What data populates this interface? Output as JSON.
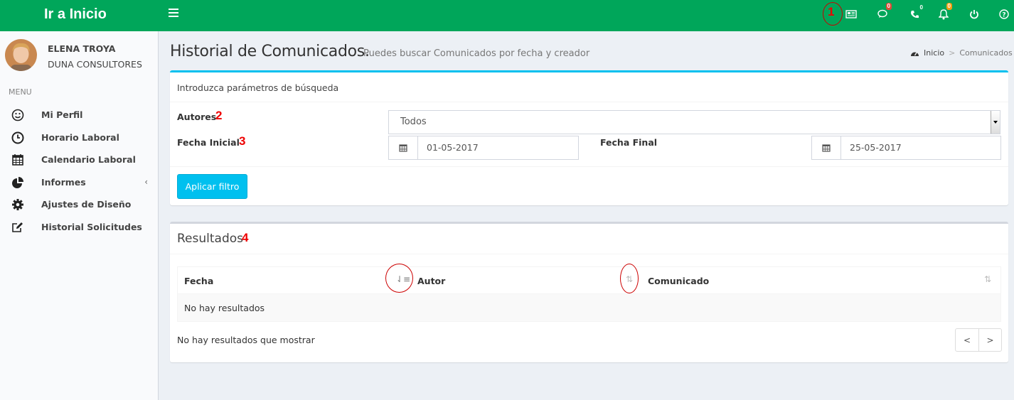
{
  "header": {
    "logo_text": "Ir a Inicio",
    "badges": {
      "messages": "0",
      "calls": "0",
      "notifications": "0"
    },
    "colors": {
      "bar": "#00a65a",
      "badge_red": "#dd4b39",
      "badge_orange": "#f39c12"
    }
  },
  "annotations": {
    "a1": "1",
    "a2": "2",
    "a3": "3",
    "a4": "4"
  },
  "sidebar": {
    "user_name": "ELENA TROYA",
    "user_company": "DUNA CONSULTORES",
    "menu_header": "MENU",
    "items": [
      {
        "label": "Mi Perfil",
        "icon": "smile-icon"
      },
      {
        "label": "Horario Laboral",
        "icon": "clock-icon"
      },
      {
        "label": "Calendario Laboral",
        "icon": "calendar-icon"
      },
      {
        "label": "Informes",
        "icon": "pie-chart-icon"
      },
      {
        "label": "Ajustes de Diseño",
        "icon": "gear-icon"
      },
      {
        "label": "Historial Solicitudes",
        "icon": "edit-icon"
      }
    ]
  },
  "page": {
    "title": "Historial de Comunicados.",
    "subtitle": "Puedes buscar Comunicados por fecha y creador",
    "breadcrumb": {
      "home": "Inicio",
      "separator": ">",
      "current": "Comunicados"
    }
  },
  "search": {
    "heading": "Introduzca parámetros de búsqueda",
    "autores_label": "Autores",
    "autores_value": "Todos",
    "fecha_inicial_label": "Fecha Inicial",
    "fecha_inicial_value": "01-05-2017",
    "fecha_final_label": "Fecha Final",
    "fecha_final_value": "25-05-2017",
    "apply_button": "Aplicar filtro"
  },
  "results": {
    "title": "Resultados",
    "columns": [
      "Fecha",
      "Autor",
      "Comunicado"
    ],
    "empty_row": "No hay resultados",
    "info": "No hay resultados que mostrar",
    "pager": {
      "prev": "<",
      "next": ">"
    }
  }
}
